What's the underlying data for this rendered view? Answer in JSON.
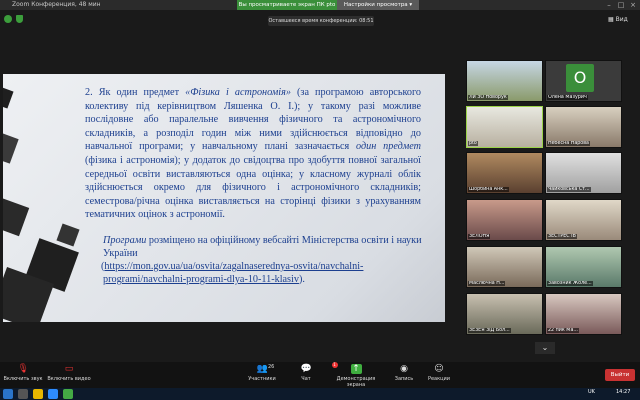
{
  "window": {
    "title": "Zoom Конференция, 48 мин"
  },
  "share_banner": {
    "status": "Вы просматриваете экран ПК pto",
    "options_label": "Настройки просмотра ▾"
  },
  "meeting": {
    "remaining": "Оставшееся время конференции: 08:51",
    "view_label": "▦ Вид"
  },
  "slide": {
    "p1_a": "2. Як один предмет ",
    "p1_b": "«Фізика і астрономія»",
    "p1_c": " (за програмою авторського колективу під керівництвом Ляшенка О. І.); у такому разі можливе послідовне або паралельне вивчення фізичного та астрономічного складників, а розподіл годин між ними здійснюється відповідно до навчальної програми; у навчальному плані зазначається ",
    "p1_d": "один предмет",
    "p1_e": " (фізика і астрономія); у додаток до свідоцтва про здобуття повної загальної середньої освіти виставляються одна оцінка; у класному журналі облік здійснюється окремо для фізичного і астрономічного складників; семестрова/річна оцінка виставляється на сторінці фізики з урахуванням тематичних оцінок з астрономії.",
    "p2_a": "Програми",
    "p2_b": " розміщено на офіційному вебсайті Міністерства освіти і науки України",
    "p2_link": "https://mon.gov.ua/ua/osvita/zagalnaserednya-osvita/navchalni-programi/navchalni-programi-dlya-10-11-klasiv",
    "p2_open": "(",
    "p2_close": ")."
  },
  "participants": [
    {
      "name": "Ли ЗО Новорук"
    },
    {
      "name": "Олена Мазурич"
    },
    {
      "name": "pto"
    },
    {
      "name": "Небесна Нарова"
    },
    {
      "name": "Шорбина Анк..."
    },
    {
      "name": "Чайковська Ст..."
    },
    {
      "name": "ЗЕЛОНЯ"
    },
    {
      "name": "ЗЕСТРЕС ІВ"
    },
    {
      "name": "Маслючна Н..."
    },
    {
      "name": "Завозник Жоле..."
    },
    {
      "name": "ЗЕЗЕЯ ЗІД Бол..."
    },
    {
      "name": "22 пик Ма..."
    }
  ],
  "avatar_letter": "О",
  "controls": {
    "mic": "Включить звук",
    "video": "Включить видео",
    "participants": "Участники",
    "participants_count": "26",
    "chat": "Чат",
    "chat_badge": "1",
    "share": "Демонстрация экрана",
    "record": "Запись",
    "reactions": "Реакции",
    "leave": "Выйти"
  },
  "taskbar": {
    "clock": "14:27",
    "lang": "UK"
  },
  "colors": {
    "slide_text": "#1c3f8f",
    "share_green": "#3a8f3a",
    "leave_red": "#c83232"
  }
}
